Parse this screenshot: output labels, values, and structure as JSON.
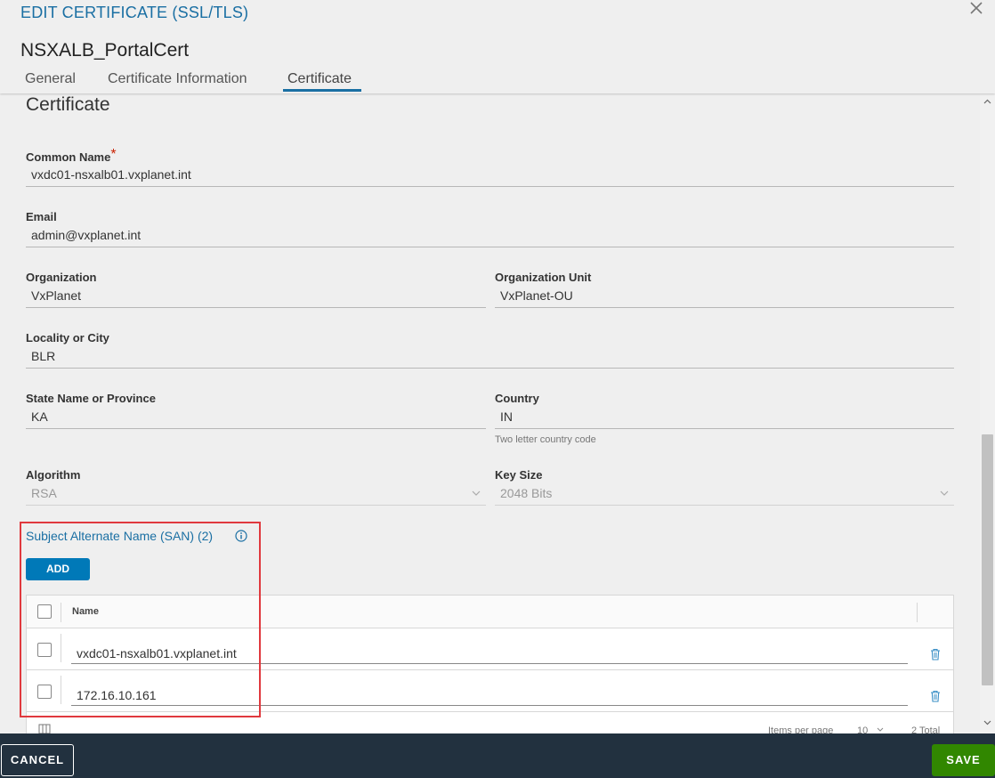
{
  "dialog": {
    "title": "EDIT CERTIFICATE (SSL/TLS)",
    "cert_name": "NSXALB_PortalCert",
    "tabs": [
      {
        "label": "General"
      },
      {
        "label": "Certificate Information"
      },
      {
        "label": "Certificate"
      }
    ],
    "active_tab": "Certificate"
  },
  "section": {
    "title": "Certificate"
  },
  "fields": {
    "common_name": {
      "label": "Common Name",
      "required_mark": "*",
      "value": "vxdc01-nsxalb01.vxplanet.int"
    },
    "email": {
      "label": "Email",
      "value": "admin@vxplanet.int"
    },
    "organization": {
      "label": "Organization",
      "value": "VxPlanet"
    },
    "organization_unit": {
      "label": "Organization Unit",
      "value": "VxPlanet-OU"
    },
    "locality": {
      "label": "Locality or City",
      "value": "BLR"
    },
    "state": {
      "label": "State Name or Province",
      "value": "KA"
    },
    "country": {
      "label": "Country",
      "value": "IN",
      "helper": "Two letter country code"
    },
    "algorithm": {
      "label": "Algorithm",
      "value": "RSA"
    },
    "key_size": {
      "label": "Key Size",
      "value": "2048 Bits"
    }
  },
  "san": {
    "title": "Subject Alternate Name (SAN) (2)",
    "add_label": "ADD",
    "column_name": "Name",
    "rows": [
      {
        "value": "vxdc01-nsxalb01.vxplanet.int"
      },
      {
        "value": "172.16.10.161"
      }
    ],
    "footer": {
      "items_per_page_label": "Items per page",
      "items_per_page": "10",
      "total": "2 Total"
    }
  },
  "footer": {
    "cancel_label": "CANCEL",
    "save_label": "SAVE"
  },
  "colors": {
    "accent": "#1a6fa3",
    "primary_button": "#0079b8",
    "save_button": "#318700",
    "footer_bg": "#22313f",
    "highlight_box": "#e0393e",
    "required": "#c92100"
  }
}
